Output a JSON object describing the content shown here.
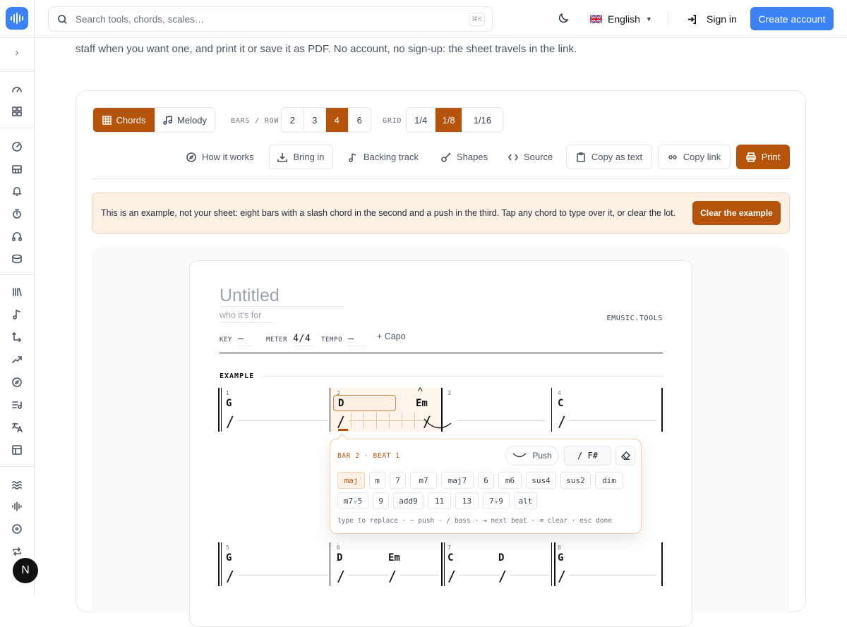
{
  "search": {
    "placeholder": "Search tools, chords, scales…",
    "shortcut": "⌘K"
  },
  "header": {
    "language": "English",
    "sign_in": "Sign in",
    "create_account": "Create account"
  },
  "intro": {
    "text": "staff when you want one, and print it or save it as PDF. No account, no sign-up: the sheet travels in the link."
  },
  "mode": {
    "chords": "Chords",
    "melody": "Melody"
  },
  "bars_per_row": {
    "label": "BARS / ROW",
    "options": [
      "2",
      "3",
      "4",
      "6"
    ],
    "selected": "4"
  },
  "grid": {
    "label": "GRID",
    "options": [
      "1/4",
      "1/8",
      "1/16"
    ],
    "selected": "1/8"
  },
  "toolbar": {
    "how_it_works": "How it works",
    "bring_in": "Bring in",
    "backing_track": "Backing track",
    "shapes": "Shapes",
    "source": "Source",
    "copy_as_text": "Copy as text",
    "copy_link": "Copy link",
    "print": "Print"
  },
  "notice": {
    "text": "This is an example, not your sheet: eight bars with a slash chord in the second and a push in the third. Tap any chord to type over it, or clear the lot.",
    "clear_label": "Clear the example"
  },
  "sheet": {
    "title": "Untitled",
    "for": "who it's for",
    "brand": "EMUSIC.TOOLS",
    "key_label": "KEY",
    "key_value": "—",
    "meter_label": "METER",
    "meter_value": "4/4",
    "tempo_label": "TEMPO",
    "tempo_value": "—",
    "capo": "+ Capo",
    "section": "EXAMPLE"
  },
  "bars": [
    {
      "num": "1",
      "chords": [
        "G"
      ]
    },
    {
      "num": "2",
      "chords": [
        "D",
        "Em"
      ]
    },
    {
      "num": "3",
      "chords": []
    },
    {
      "num": "4",
      "chords": [
        "C"
      ]
    },
    {
      "num": "5",
      "chords": [
        "G"
      ]
    },
    {
      "num": "6",
      "chords": [
        "D",
        "Em"
      ]
    },
    {
      "num": "7",
      "chords": [
        "C",
        "D"
      ]
    },
    {
      "num": "8",
      "chords": [
        "G"
      ]
    }
  ],
  "popover": {
    "title": "BAR 2 · BEAT 1",
    "push": "Push",
    "bass": "/ F#",
    "qualities_row1": [
      "maj",
      "m",
      "7",
      "m7",
      "maj7",
      "6",
      "m6",
      "sus4",
      "sus2",
      "dim"
    ],
    "qualities_row2": [
      "m7♭5",
      "9",
      "add9",
      "11",
      "13",
      "7♭9",
      "alt"
    ],
    "selected": "maj",
    "hint": "type to replace · ~ push · / bass · ⇥ next beat · ⌫ clear · esc done"
  },
  "colors": {
    "accent": "#b45309",
    "brand": "#3b82f6",
    "notice_bg": "#fdf0e5"
  },
  "user": {
    "initial": "N"
  }
}
